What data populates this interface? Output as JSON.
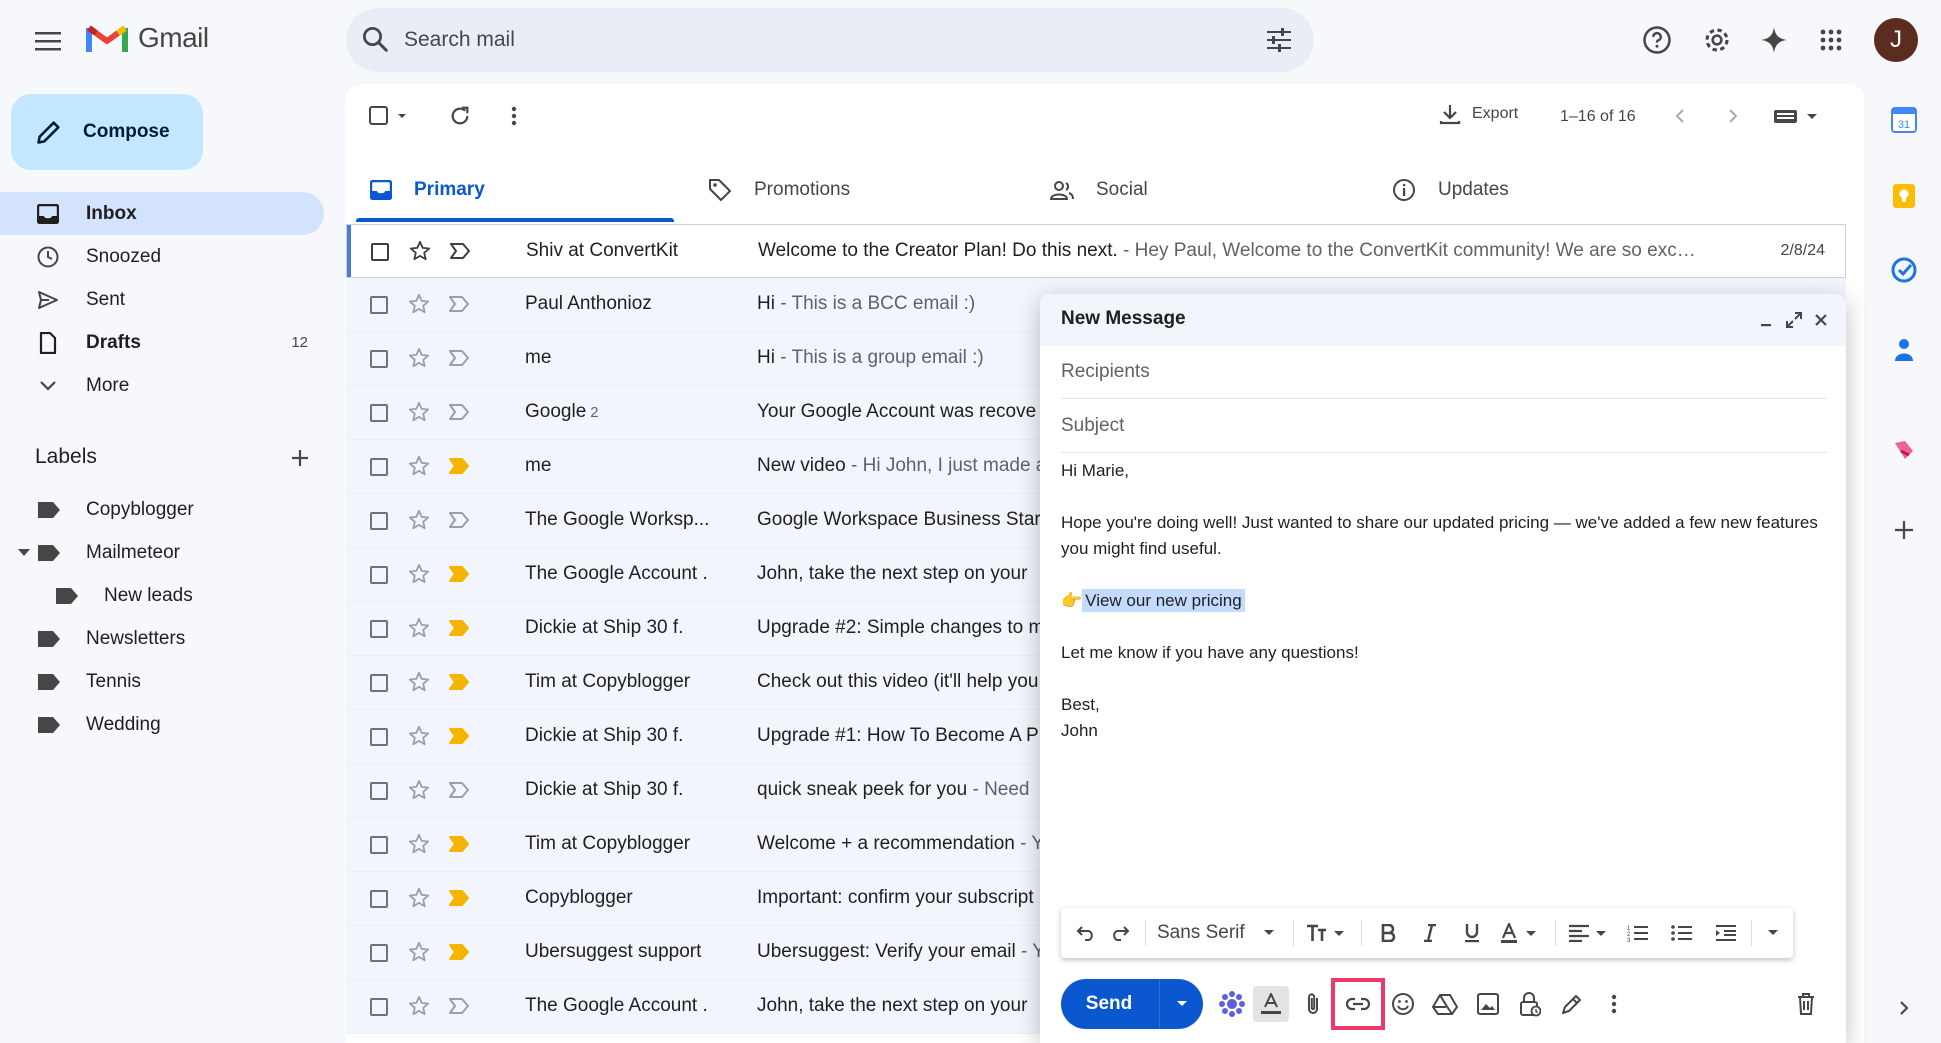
{
  "app": {
    "name": "Gmail"
  },
  "search": {
    "placeholder": "Search mail"
  },
  "avatar": {
    "initial": "J",
    "color": "#5b2d1f"
  },
  "compose_button": {
    "label": "Compose"
  },
  "nav": [
    {
      "label": "Inbox",
      "icon": "inbox-icon",
      "active": true,
      "count": ""
    },
    {
      "label": "Snoozed",
      "icon": "clock-icon",
      "active": false,
      "count": ""
    },
    {
      "label": "Sent",
      "icon": "send-icon",
      "active": false,
      "count": ""
    },
    {
      "label": "Drafts",
      "icon": "draft-icon",
      "active": false,
      "count": "12"
    },
    {
      "label": "More",
      "icon": "chevron-down-icon",
      "active": false,
      "count": ""
    }
  ],
  "labels": {
    "title": "Labels",
    "items": [
      {
        "label": "Copyblogger"
      },
      {
        "label": "Mailmeteor"
      },
      {
        "label": "New leads"
      },
      {
        "label": "Newsletters"
      },
      {
        "label": "Tennis"
      },
      {
        "label": "Wedding"
      }
    ]
  },
  "toolbar": {
    "export_label": "Export",
    "pager": "1–16 of 16"
  },
  "tabs": [
    {
      "label": "Primary",
      "icon": "inbox-tab-icon"
    },
    {
      "label": "Promotions",
      "icon": "tag-icon"
    },
    {
      "label": "Social",
      "icon": "people-icon"
    },
    {
      "label": "Updates",
      "icon": "info-icon"
    }
  ],
  "emails": [
    {
      "sender": "Shiv at ConvertKit",
      "count": "",
      "subject": "Welcome to the Creator Plan! Do this next.",
      "snippet": " - Hey Paul, Welcome to the ConvertKit community! We are so exc…",
      "date": "2/8/24",
      "important": false
    },
    {
      "sender": "Paul Anthonioz",
      "count": "",
      "subject": "Hi",
      "snippet": " - This is a BCC email :)",
      "date": "",
      "important": false
    },
    {
      "sender": "me",
      "count": "",
      "subject": "Hi",
      "snippet": " - This is a group email :)",
      "date": "",
      "important": false
    },
    {
      "sender": "Google",
      "count": "2",
      "subject": "Your Google Account was recove",
      "snippet": "",
      "date": "",
      "important": false
    },
    {
      "sender": "me",
      "count": "",
      "subject": "New video",
      "snippet": " - Hi John, I just made a",
      "date": "",
      "important": true
    },
    {
      "sender": "The Google Worksp...",
      "count": "",
      "subject": "Google Workspace Business Star",
      "snippet": "",
      "date": "",
      "important": false
    },
    {
      "sender": "The Google Account .",
      "count": "",
      "subject": "John, take the next step on your",
      "snippet": "",
      "date": "",
      "important": true
    },
    {
      "sender": "Dickie at Ship 30 f.",
      "count": "",
      "subject": "Upgrade #2: Simple changes to m",
      "snippet": "",
      "date": "",
      "important": true
    },
    {
      "sender": "Tim at Copyblogger",
      "count": "",
      "subject": "Check out this video (it'll help you",
      "snippet": "",
      "date": "",
      "important": true
    },
    {
      "sender": "Dickie at Ship 30 f.",
      "count": "",
      "subject": "Upgrade #1: How To Become A P",
      "snippet": "",
      "date": "",
      "important": true
    },
    {
      "sender": "Dickie at Ship 30 f.",
      "count": "",
      "subject": "quick sneak peek for you",
      "snippet": " - Need",
      "date": "",
      "important": false
    },
    {
      "sender": "Tim at Copyblogger",
      "count": "",
      "subject": "Welcome + a recommendation",
      "snippet": " - Y",
      "date": "",
      "important": true
    },
    {
      "sender": "Copyblogger",
      "count": "",
      "subject": "Important: confirm your subscript",
      "snippet": "",
      "date": "",
      "important": true
    },
    {
      "sender": "Ubersuggest support",
      "count": "",
      "subject": "Ubersuggest: Verify your email",
      "snippet": " - Y",
      "date": "",
      "important": true
    },
    {
      "sender": "The Google Account .",
      "count": "",
      "subject": "John, take the next step on your",
      "snippet": "",
      "date": "",
      "important": false
    }
  ],
  "compose_window": {
    "title": "New Message",
    "recipients_placeholder": "Recipients",
    "subject_placeholder": "Subject",
    "greeting": "Hi Marie,",
    "paragraph1": "Hope you're doing well! Just wanted to share our updated pricing — we've added a few new features you might find useful.",
    "emoji": "👉",
    "link_text": "View our new pricing",
    "paragraph2": "Let me know if you have any questions!",
    "signoff": "Best,",
    "signature": "John",
    "font_name": "Sans Serif",
    "send_label": "Send"
  },
  "colors": {
    "accent": "#0b57d0",
    "compose_bg": "#c2e7ff",
    "active_nav": "#d3e3fd",
    "important": "#f4b400",
    "highlight": "#e83b6a"
  }
}
